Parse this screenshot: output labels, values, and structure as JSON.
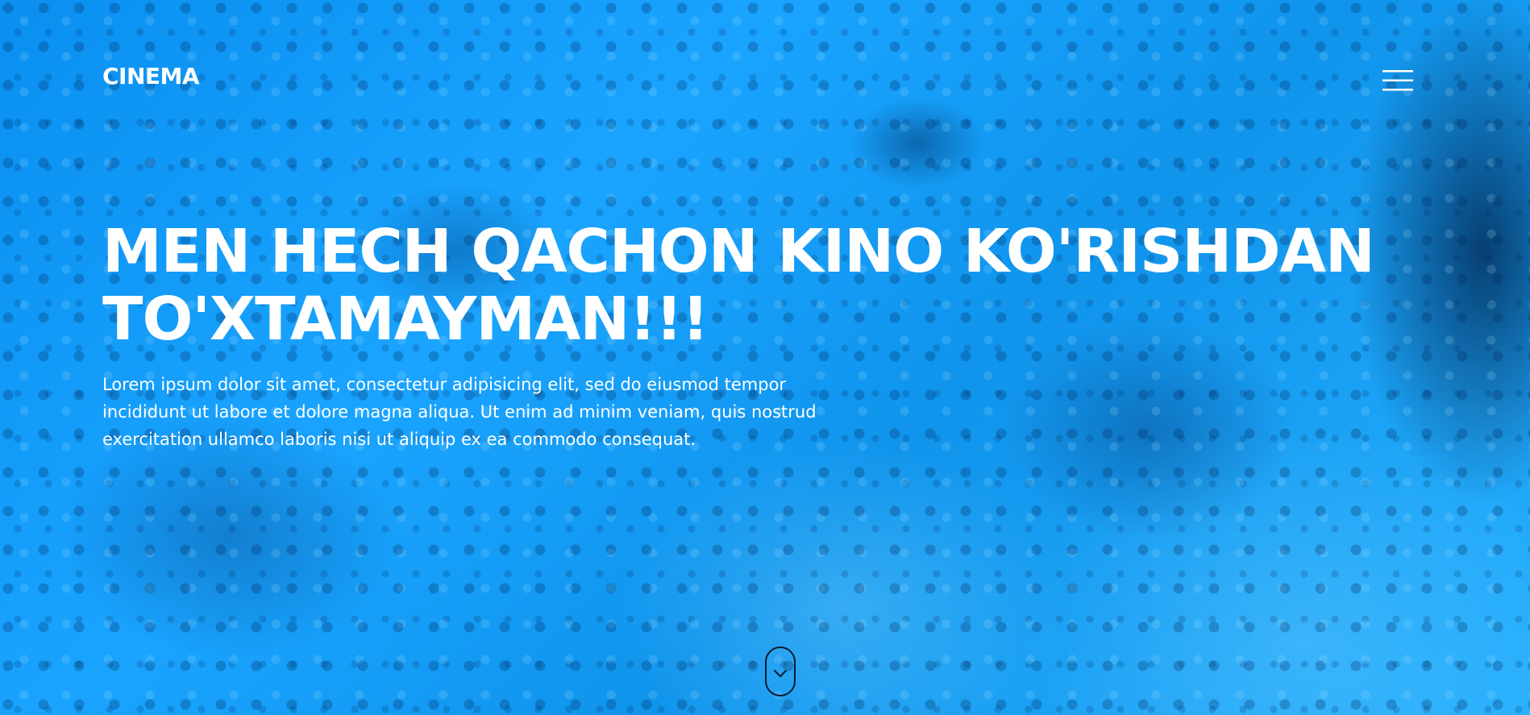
{
  "header": {
    "brand": "CINEMA",
    "menu_icon": "hamburger-menu-icon"
  },
  "hero": {
    "title": "MEN HECH QACHON KINO KO'RISHDAN TO'XTAMAYMAN!!!",
    "description": "Lorem ipsum dolor sit amet, consectetur adipisicing elit, sed do eiusmod tempor incididunt ut labore et dolore magna aliqua. Ut enim ad minim veniam, quis nostrud exercitation ullamco laboris nisi ut aliquip ex ea commodo consequat.",
    "scroll_icon": "chevron-down-icon"
  },
  "colors": {
    "background": "#1aa4ff",
    "text": "#ffffff",
    "scroll_outline": "#0b1b2e"
  }
}
